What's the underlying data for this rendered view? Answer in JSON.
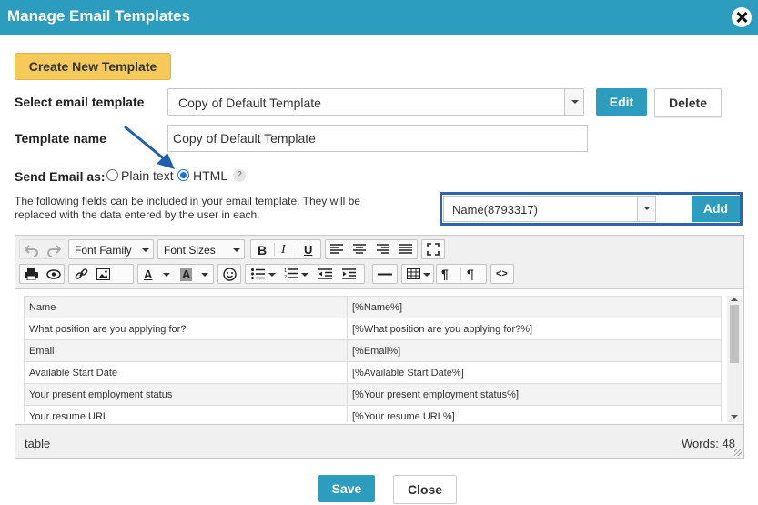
{
  "dialog": {
    "title": "Manage Email Templates"
  },
  "buttons": {
    "create": "Create New Template",
    "edit": "Edit",
    "delete": "Delete",
    "add": "Add",
    "save": "Save",
    "close": "Close"
  },
  "form": {
    "select_template_label": "Select email template",
    "selected_template": "Copy of Default Template",
    "template_name_label": "Template name",
    "template_name_value": "Copy of Default Template",
    "send_as_label": "Send Email as:",
    "send_as_options": [
      "Plain text",
      "HTML"
    ],
    "send_as_selected": "HTML",
    "help_glyph": "?",
    "description": "The following fields can be included in your email template. They will be replaced with the data entered by the user in each.",
    "field_selected": "Name(8793317)"
  },
  "editor": {
    "toolbar": {
      "font_family": "Font Family",
      "font_sizes": "Font Sizes",
      "bold": "B",
      "italic": "I",
      "underline": "U",
      "paragraph": "¶",
      "code": "<>",
      "text_color": "A",
      "bg_color": "A"
    },
    "table_rows": [
      {
        "label": "Name",
        "placeholder": "[%Name%]"
      },
      {
        "label": "What position are you applying for?",
        "placeholder": "[%What position are you applying for?%]"
      },
      {
        "label": "Email",
        "placeholder": "[%Email%]"
      },
      {
        "label": "Available Start Date",
        "placeholder": "[%Available Start Date%]"
      },
      {
        "label": "Your present employment status",
        "placeholder": "[%Your present employment status%]"
      },
      {
        "label": "Your resume URL",
        "placeholder": "[%Your resume URL%]"
      }
    ],
    "status_path": "table",
    "word_count": "Words: 48"
  },
  "colors": {
    "accent": "#2d9dbf",
    "create_button": "#f5c95a",
    "highlight_border": "#2d64ae",
    "annotation_arrow": "#1f5fb0"
  }
}
